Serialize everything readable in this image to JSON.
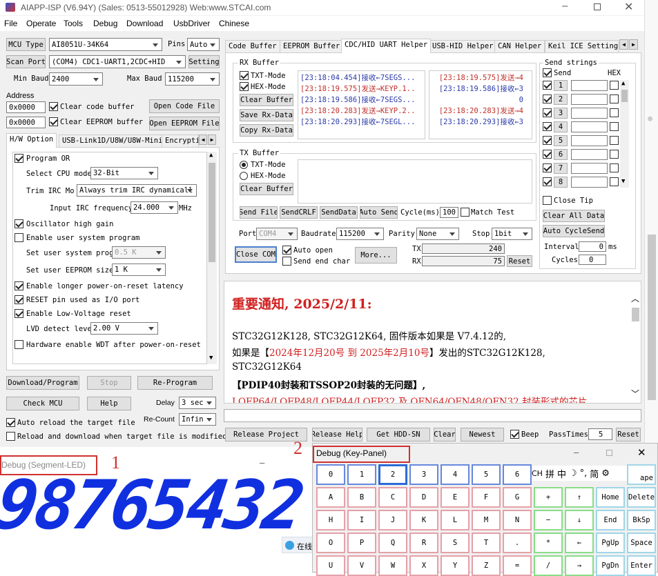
{
  "title_bar": {
    "title": "AIAPP-ISP (V6.94Y) (Sales: 0513-55012928) Web:www.STCAI.com"
  },
  "menu": [
    "File",
    "Operate",
    "Tools",
    "Debug",
    "Download",
    "UsbDriver",
    "Chinese"
  ],
  "left": {
    "mcu_type_btn": "MCU Type",
    "mcu_type": "AI8051U-34K64",
    "pins_label": "Pins",
    "pins": "Auto",
    "scan_port_btn": "Scan Port",
    "port": "(COM4) CDC1-UART1,2CDC+HID",
    "setting_btn": "Setting",
    "min_baud_label": "Min Baud",
    "min_baud": "2400",
    "max_baud_label": "Max Baud",
    "max_baud": "115200",
    "address_label": "Address",
    "addr1": "0x0000",
    "addr2": "0x0000",
    "clear_code": "Clear code buffer",
    "clear_eeprom": "Clear EEPROM buffer",
    "open_code_btn": "Open Code File",
    "open_eeprom_btn": "Open EEPROM File",
    "tabs": [
      "H/W Option",
      "USB-Link1D/U8W/U8W-Mini",
      "Encrypti"
    ],
    "opt_program_or": "Program OR",
    "cpu_mode_label": "Select CPU mode",
    "cpu_mode": "32-Bit",
    "trim_label": "Trim IRC Mo",
    "trim": "Always trim IRC dynamicall",
    "irc_label": "Input IRC frequency",
    "irc": "24.000",
    "irc_unit": "MHz",
    "osc_gain": "Oscillator high gain",
    "user_sys": "Enable user system program",
    "user_prog_label": "Set user system prog",
    "user_prog": "0.5 K",
    "user_eeprom_label": "Set user EEPROM size",
    "user_eeprom": "1   K",
    "longer_por": "Enable longer power-on-reset latency",
    "reset_io": "RESET pin used as I/O port",
    "low_volt": "Enable Low-Voltage reset",
    "lvd_label": "LVD detect leve",
    "lvd": "2.00 V",
    "hw_wdt": "Hardware enable WDT after power-on-reset",
    "download_btn": "Download/Program",
    "stop_btn": "Stop",
    "reprogram_btn": "Re-Program",
    "check_mcu_btn": "Check MCU",
    "help_btn": "Help",
    "delay_label": "Delay",
    "delay": "3 sec",
    "auto_reload": "Auto reload the target file",
    "recount_label": "Re-Count",
    "recount": "Infin",
    "reload_download": "Reload and download when target file is modified"
  },
  "right_tabs": [
    "Code Buffer",
    "EEPROM Buffer",
    "CDC/HID UART Helper",
    "USB-HID Helper",
    "CAN Helper",
    "Keil ICE Settings"
  ],
  "uart": {
    "rx_buffer_label": "RX Buffer",
    "txt_mode": "TXT-Mode",
    "hex_mode": "HEX-Mode",
    "clear_buffer_btn": "Clear Buffer",
    "save_rx_btn": "Save Rx-Data",
    "copy_rx_btn": "Copy Rx-Data",
    "rx_left": [
      {
        "t": "[23:18:04.454]接收←7SEGS...",
        "c": "blue"
      },
      {
        "t": "[23:18:19.575]发送→KEYP.1..",
        "c": "red"
      },
      {
        "t": "[23:18:19.586]接收←7SEGS...",
        "c": "blue"
      },
      {
        "t": "[23:18:20.283]发送→KEYP.2..",
        "c": "red"
      },
      {
        "t": "[23:18:20.293]接收←7SEGL...",
        "c": "blue"
      }
    ],
    "rx_right": [
      {
        "t": "[23:18:19.575]发送→4",
        "c": "red"
      },
      {
        "t": "[23:18:19.586]接收←3",
        "c": "blue"
      },
      {
        "t": "0",
        "c": "blue"
      },
      {
        "t": "[23:18:20.283]发送→4",
        "c": "red"
      },
      {
        "t": "[23:18:20.293]接收←3",
        "c": "blue"
      }
    ],
    "tx_buffer_label": "TX Buffer",
    "tx_txt_mode": "TXT-Mode",
    "tx_hex_mode": "HEX-Mode",
    "tx_clear_btn": "Clear Buffer",
    "send_file_btn": "Send File",
    "send_crlf_btn": "SendCRLF",
    "send_data_btn": "SendData",
    "auto_send_btn": "Auto Send",
    "cycle_label": "Cycle(ms)",
    "cycle": "100",
    "match_test": "Match Test",
    "send_strings_label": "Send strings",
    "send_label": "Send",
    "hex_label": "HEX",
    "send_rows": [
      "1",
      "2",
      "3",
      "4",
      "5",
      "6",
      "7",
      "8"
    ],
    "close_tip": "Close Tip",
    "clear_all_btn": "Clear All Data",
    "auto_cycle_btn": "Auto CycleSend",
    "interval_label": "Interval",
    "interval": "0",
    "interval_unit": "ms",
    "cycles_label": "Cycles",
    "cycles": "0",
    "port_label": "Port",
    "port": "COM4",
    "baud_label": "Baudrate",
    "baud": "115200",
    "parity_label": "Parity",
    "parity": "None",
    "stop_label": "Stop",
    "stop": "1bit",
    "close_com_btn": "Close COM",
    "auto_open": "Auto open",
    "send_end_char": "Send end char",
    "more_btn": "More...",
    "tx_label": "TX",
    "tx_count": "240",
    "rx_label": "RX",
    "rx_count": "75",
    "reset_btn": "Reset"
  },
  "notice": {
    "title": "重要通知, 2025/2/11:",
    "line1": "STC32G12K128, STC32G12K64, 固件版本如果是 V7.4.12的,",
    "line2a": "如果是【",
    "line2b": "2024年12月20号 到 2025年2月10号",
    "line2c": "】发出的STC32G12K128,",
    "line3": "STC32G12K64",
    "line4": "【PDIP40封装和TSSOP20封装的无问题】,",
    "line5": "LQFP64/LQFP48/LQFP44/LQFP32 及 QFN64/QFN48/QFN32 封装形式的芯片,"
  },
  "bottom": {
    "release_project_btn": "Release Project",
    "release_help_btn": "Release Help",
    "get_hdd_btn": "Get HDD-SN",
    "clear_btn": "Clear",
    "newest_btn": "Newest",
    "beep": "Beep",
    "pass_label": "PassTimes",
    "pass_count": "5",
    "reset_btn": "Reset"
  },
  "seg_window": {
    "title": "Debug (Segment-LED)",
    "marker": "1",
    "digits": "98765432"
  },
  "key_window": {
    "title": "Debug (Key-Panel)",
    "marker": "2",
    "ime": [
      "CH",
      "拼",
      "中",
      "☽",
      "°,",
      "简",
      "⚙"
    ],
    "rows": [
      [
        "0",
        "1",
        "2",
        "3",
        "4",
        "5",
        "6",
        "",
        "",
        "ape"
      ],
      [
        "A",
        "B",
        "C",
        "D",
        "E",
        "F",
        "G",
        "+",
        "↑",
        "Home",
        "Delete"
      ],
      [
        "H",
        "I",
        "J",
        "K",
        "L",
        "M",
        "N",
        "−",
        "↓",
        "End",
        "BkSp"
      ],
      [
        "O",
        "P",
        "Q",
        "R",
        "S",
        "T",
        ".",
        "*",
        "←",
        "PgUp",
        "Space"
      ],
      [
        "U",
        "V",
        "W",
        "X",
        "Y",
        "Z",
        "=",
        "/",
        "→",
        "PgDn",
        "Enter"
      ]
    ]
  },
  "taskbar_text": "在线"
}
